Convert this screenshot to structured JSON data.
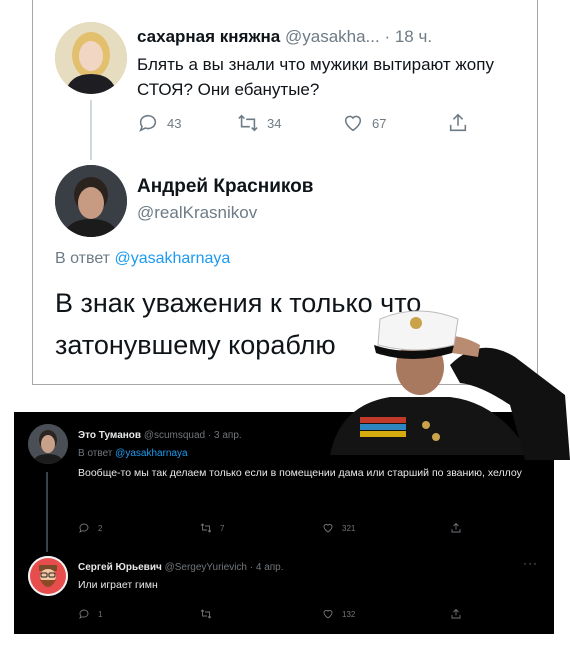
{
  "tweet1": {
    "name": "сахарная княжна",
    "handle": "@yasakha...",
    "time": "· 18 ч.",
    "text": "Блять а вы знали что мужики вытирают жопу СТОЯ? Они ебанутые?",
    "replies": "43",
    "retweets": "34",
    "likes": "67"
  },
  "tweet2": {
    "name": "Андрей Красников",
    "handle": "@realKrasnikov",
    "reply_prefix": "В ответ",
    "reply_handle": "@yasakharnaya",
    "text": "В знак уважения к только что затонувшему кораблю"
  },
  "dark_tweet1": {
    "name": "Это Туманов",
    "meta": "@scumsquad · 3 апр.",
    "reply_prefix": "В ответ",
    "reply_handle": "@yasakharnaya",
    "text": "Вообще-то мы так делаем только если в помещении дама или старший по званию, хеллоу",
    "replies": "2",
    "retweets": "7",
    "likes": "321"
  },
  "dark_tweet2": {
    "name": "Сергей Юрьевич",
    "meta": "@SergeyYurievich · 4 апр.",
    "more": "···",
    "text": "Или играет гимн",
    "replies": "1",
    "retweets": "",
    "likes": "132"
  },
  "colors": {
    "link": "#1d9bf0",
    "muted_light": "#6e7b85",
    "dark_bg": "#000000",
    "muted_dark": "#71767b"
  },
  "icons": [
    "reply-icon",
    "retweet-icon",
    "like-icon",
    "share-icon",
    "more-icon"
  ]
}
